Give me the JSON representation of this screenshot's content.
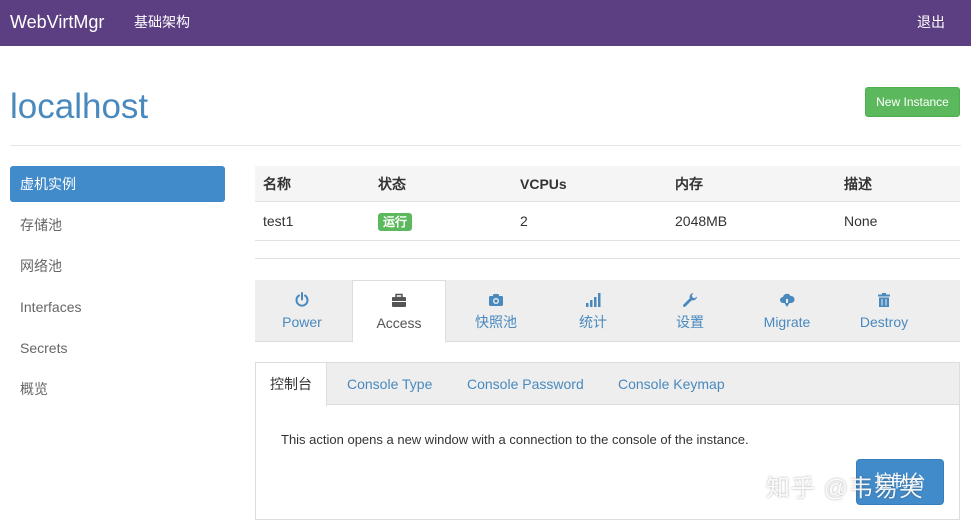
{
  "navbar": {
    "brand": "WebVirtMgr",
    "infra_link": "基础架构",
    "logout": "退出"
  },
  "header": {
    "title": "localhost",
    "new_instance_label": "New Instance"
  },
  "sidebar": {
    "items": [
      {
        "label": "虚机实例",
        "active": true
      },
      {
        "label": "存储池"
      },
      {
        "label": "网络池"
      },
      {
        "label": "Interfaces"
      },
      {
        "label": "Secrets"
      },
      {
        "label": "概览"
      }
    ]
  },
  "table": {
    "headers": [
      "名称",
      "状态",
      "VCPUs",
      "内存",
      "描述"
    ],
    "row": {
      "name": "test1",
      "status": "运行",
      "vcpus": "2",
      "memory": "2048MB",
      "description": "None"
    }
  },
  "actions": {
    "tabs": [
      {
        "label": "Power",
        "icon": "power-icon"
      },
      {
        "label": "Access",
        "icon": "briefcase-icon",
        "active": true
      },
      {
        "label": "快照池",
        "icon": "camera-icon"
      },
      {
        "label": "统计",
        "icon": "signal-icon"
      },
      {
        "label": "设置",
        "icon": "wrench-icon"
      },
      {
        "label": "Migrate",
        "icon": "cloud-download-icon"
      },
      {
        "label": "Destroy",
        "icon": "trash-icon"
      }
    ]
  },
  "console": {
    "tabs": [
      "控制台",
      "Console Type",
      "Console Password",
      "Console Keymap"
    ],
    "description": "This action opens a new window with a connection to the console of the instance.",
    "button_label": "控制台"
  },
  "watermark": "知乎 @韦易笑",
  "colors": {
    "navbar": "#5b3f82",
    "accent": "#428bca",
    "title": "#4a89be",
    "success": "#5cb85c"
  }
}
